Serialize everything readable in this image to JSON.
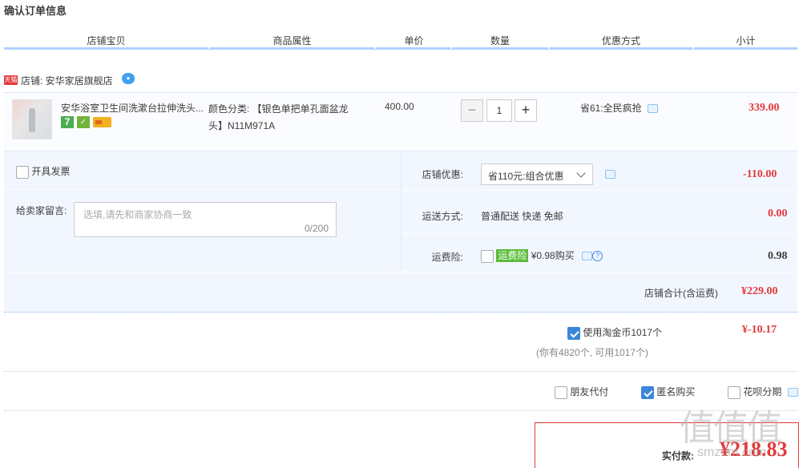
{
  "page": {
    "title": "确认订单信息"
  },
  "table_header": [
    "店铺宝贝",
    "商品属性",
    "单价",
    "数量",
    "优惠方式",
    "小计"
  ],
  "shop": {
    "badge": "天猫",
    "label": "店铺: 安华家居旗舰店"
  },
  "item": {
    "name": "安华浴室卫生间洗漱台拉伸洗头...",
    "svc_icon_1": "7",
    "attr_line1": "颜色分类: 【银色单把单孔面盆龙",
    "attr_line2": "头】N11M971A",
    "unit_price": "400.00",
    "quantity": "1",
    "minus": "−",
    "plus": "+",
    "promo": "省61:全民疯抢",
    "subtotal": "339.00"
  },
  "invoice": {
    "label": "开具发票"
  },
  "memo": {
    "label": "给卖家留言:",
    "placeholder": "选填,请先和商家协商一致",
    "count": "0/200"
  },
  "store_discount": {
    "label": "店铺优惠:",
    "selected": "省110元:组合优惠",
    "amount": "-110.00"
  },
  "shipping": {
    "label": "运送方式:",
    "value": "普通配送 快递 免邮",
    "amount": "0.00"
  },
  "insurance": {
    "label": "运费险:",
    "tag": "运费险",
    "text": "¥0.98购买",
    "amount": "0.98",
    "help": "?"
  },
  "shop_total": {
    "label": "店铺合计(含运费)",
    "amount": "¥229.00"
  },
  "coins": {
    "label": "使用淘金币1017个",
    "note": "(你有4820个, 可用1017个)",
    "amount": "¥-10.17"
  },
  "options": [
    {
      "label": "朋友代付",
      "checked": false
    },
    {
      "label": "匿名购买",
      "checked": true
    },
    {
      "label": "花呗分期",
      "checked": false
    }
  ],
  "pay": {
    "label": "实付款:",
    "amount": "¥218.83"
  },
  "watermark": {
    "text": "值值值",
    "url": "smzdm.com"
  },
  "colors": {
    "accent_red": "#e4393c",
    "header_line": "#b2d1ff",
    "panel_bg": "#f2f7ff",
    "checkbox_blue": "#3b86d8",
    "insurance_green": "#5abb3a"
  }
}
